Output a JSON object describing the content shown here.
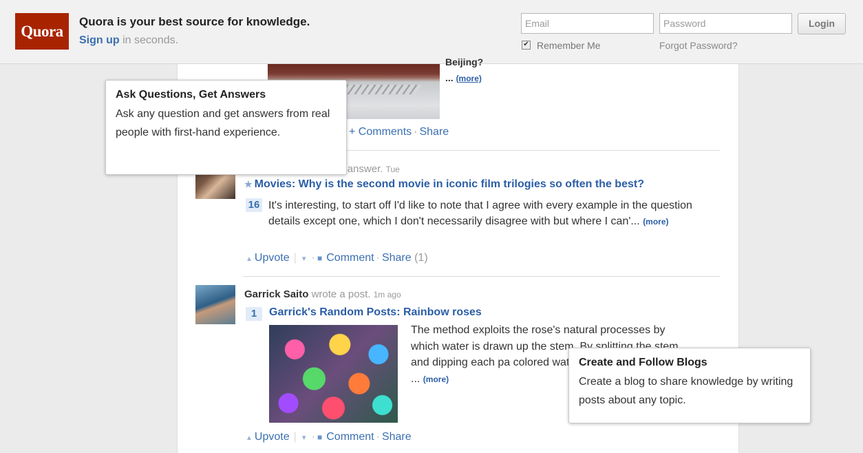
{
  "header": {
    "logo": "Quora",
    "tagline": "Quora is your best source for knowledge.",
    "signup_link": "Sign up",
    "signup_suffix": " in seconds.",
    "email_placeholder": "Email",
    "password_placeholder": "Password",
    "login_label": "Login",
    "remember_label": "Remember Me",
    "remember_checked": true,
    "forgot_label": "Forgot Password?"
  },
  "feed": {
    "item0": {
      "title_fragment": "Beijing?",
      "ellipsis": "...",
      "more": "(more)",
      "actions_fragment": "+ Comments",
      "share": "Share"
    },
    "item1": {
      "activity_fragment": "ed an answer.",
      "time": "Tue",
      "question": "Movies: Why is the second movie in iconic film trilogies so often the best?",
      "votes": "16",
      "answer": "It's interesting, to start off I'd like to note that I agree with every example in the question details except one, which I don't necessarily disagree with but where I can'...",
      "more": "(more)",
      "upvote": "Upvote",
      "comment": "Comment",
      "share": "Share",
      "share_count": "(1)"
    },
    "item2": {
      "author": "Garrick Saito",
      "activity": "wrote a post.",
      "time": "1m ago",
      "votes": "1",
      "post_title": "Garrick's Random Posts: Rainbow roses",
      "text": "The method exploits the rose's natural processes by which water is drawn up the stem. By splitting the stem and dipping each pa colored water, the colors are petals ...",
      "more": "(more)",
      "upvote": "Upvote",
      "comment": "Comment",
      "share": "Share"
    }
  },
  "tooltips": {
    "ask": {
      "title": "Ask Questions, Get Answers",
      "body": "Ask any question and get answers from real people with first-hand experience."
    },
    "blogs": {
      "title": "Create and Follow Blogs",
      "body": "Create a blog to share knowledge by writing posts about any topic."
    }
  }
}
